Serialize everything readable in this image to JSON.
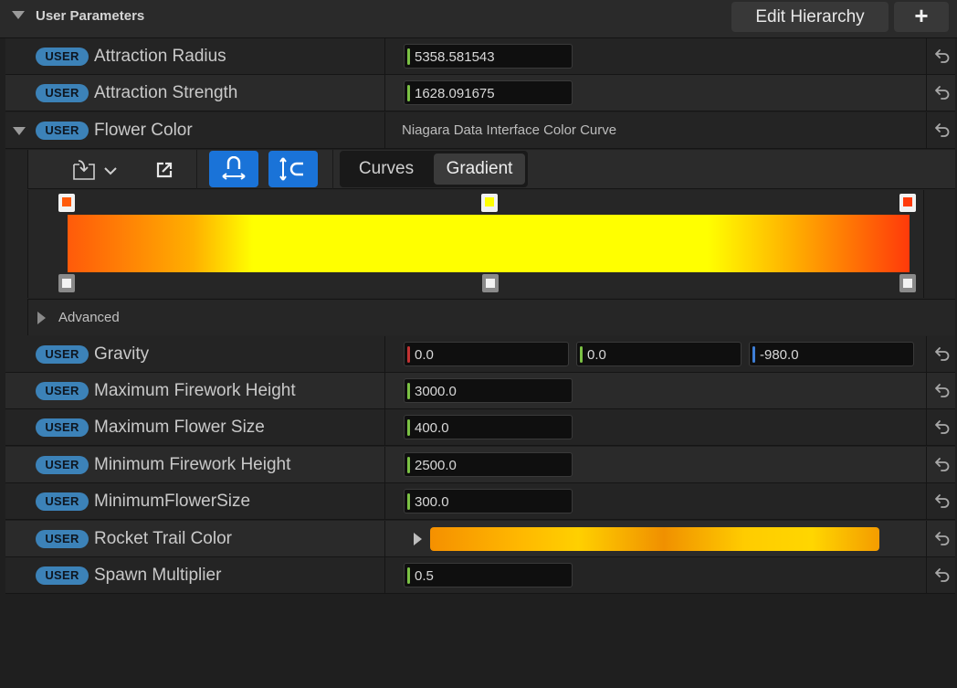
{
  "header": {
    "title": "User Parameters",
    "edit_hierarchy_label": "Edit Hierarchy",
    "add_label": "+"
  },
  "badge_label": "USER",
  "params": {
    "attraction_radius": {
      "name": "Attraction Radius",
      "value": "5358.581543"
    },
    "attraction_strength": {
      "name": "Attraction Strength",
      "value": "1628.091675"
    },
    "flower_color": {
      "name": "Flower Color",
      "type": "Niagara Data Interface Color Curve",
      "view_curves": "Curves",
      "view_gradient": "Gradient",
      "active_view": "Gradient",
      "advanced_label": "Advanced",
      "gradient_stops": [
        "#ff5a0a",
        "#ffff00",
        "#ff3a0a"
      ]
    },
    "gravity": {
      "name": "Gravity",
      "x": "0.0",
      "y": "0.0",
      "z": "-980.0"
    },
    "max_firework_height": {
      "name": "Maximum Firework Height",
      "value": "3000.0"
    },
    "max_flower_size": {
      "name": "Maximum Flower Size",
      "value": "400.0"
    },
    "min_firework_height": {
      "name": "Minimum Firework Height",
      "value": "2500.0"
    },
    "min_flower_size": {
      "name": "MinimumFlowerSize",
      "value": "300.0"
    },
    "rocket_trail_color": {
      "name": "Rocket Trail Color"
    },
    "spawn_multiplier": {
      "name": "Spawn Multiplier",
      "value": "0.5"
    }
  },
  "colors": {
    "badge": "#3c82b8",
    "accent_blue": "#1a73d8",
    "value_bar_green": "#7bc144",
    "value_bar_red": "#c23232",
    "value_bar_blue": "#3e7ed6"
  }
}
